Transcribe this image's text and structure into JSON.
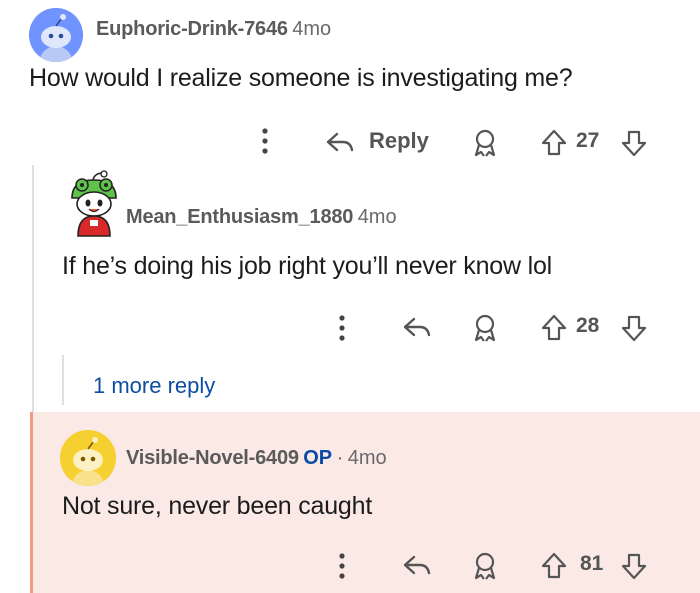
{
  "comments": [
    {
      "username": "Euphoric-Drink-7646",
      "age": "4mo",
      "text": "How would I realize someone is investigating me?",
      "reply_label": "Reply",
      "votes": "27",
      "avatar": "snoo-avatar-blue"
    },
    {
      "username": "Mean_Enthusiasm_1880",
      "age": "4mo",
      "text": "If he’s doing his job right you’ll never know lol",
      "votes": "28",
      "avatar": "snoo-avatar-frog-hat"
    },
    {
      "username": "Visible-Novel-6409",
      "op_badge": "OP",
      "separator": "·",
      "age": "4mo",
      "text": "Not sure, never been caught",
      "votes": "81",
      "avatar": "snoo-avatar-yellow"
    }
  ],
  "more_replies": "1 more reply",
  "colors": {
    "username": "#5a5a5a",
    "op_badge": "#0a4aa8",
    "link": "#0b4ea2",
    "highlight_bg": "#fbe9e6",
    "highlight_bar": "#f19a85"
  },
  "icons": [
    "more-options-icon",
    "reply-arrow-icon",
    "award-icon",
    "upvote-icon",
    "downvote-icon"
  ]
}
